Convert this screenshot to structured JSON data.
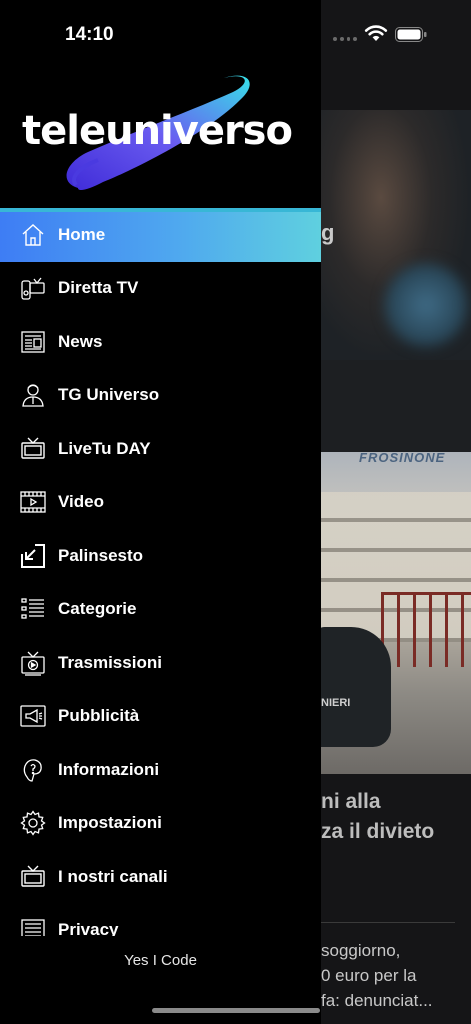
{
  "status": {
    "time": "14:10"
  },
  "brand": {
    "logo_text": "teleuniverso"
  },
  "menu": [
    {
      "label": "Home",
      "icon": "home-icon"
    },
    {
      "label": "Diretta TV",
      "icon": "live-tv-icon"
    },
    {
      "label": "News",
      "icon": "newspaper-icon"
    },
    {
      "label": "TG Universo",
      "icon": "anchor-person-icon"
    },
    {
      "label": "LiveTu DAY",
      "icon": "tv-icon"
    },
    {
      "label": "Video",
      "icon": "film-icon"
    },
    {
      "label": "Palinsesto",
      "icon": "schedule-icon"
    },
    {
      "label": "Categorie",
      "icon": "list-icon"
    },
    {
      "label": "Trasmissioni",
      "icon": "broadcast-icon"
    },
    {
      "label": "Pubblicità",
      "icon": "megaphone-icon"
    },
    {
      "label": "Informazioni",
      "icon": "info-icon"
    },
    {
      "label": "Impostazioni",
      "icon": "gear-icon"
    },
    {
      "label": "I nostri canali",
      "icon": "tv-channels-icon"
    },
    {
      "label": "Privacy",
      "icon": "document-icon"
    }
  ],
  "footer": {
    "credit": "Yes I Code"
  },
  "background": {
    "partial_letter": "g",
    "sign_text": "FROSINONE",
    "car_text": "NIERI",
    "headline_line1": "ni alla",
    "headline_line2": "za il divieto",
    "snippet_line1": "soggiorno,",
    "snippet_line2": "0 euro per la",
    "snippet_line3": "fa: denunciat..."
  },
  "colors": {
    "accent": "#38b7d6",
    "active_start": "#3e7df4",
    "active_end": "#5fd0df"
  }
}
